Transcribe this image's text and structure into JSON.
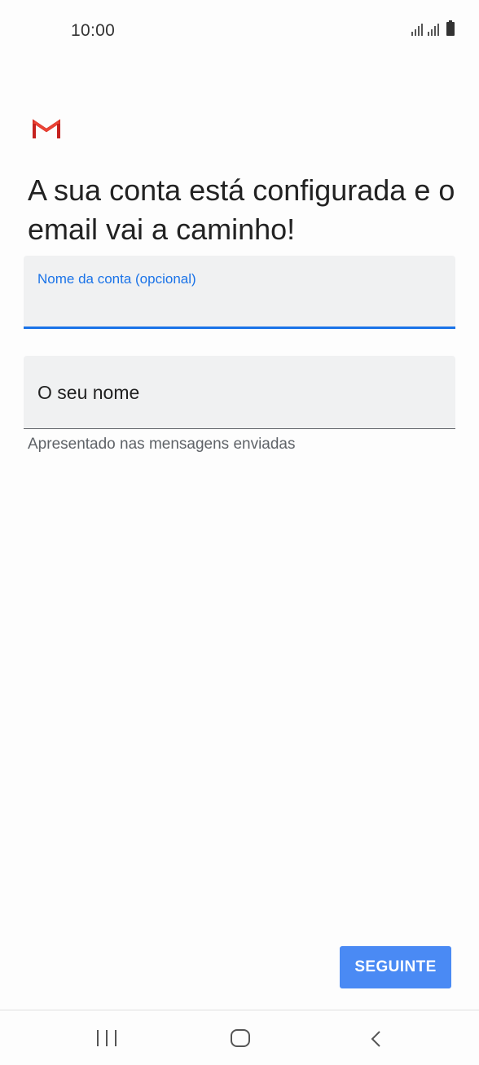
{
  "status_bar": {
    "time": "10:00",
    "icons": [
      "signal-icon",
      "signal-icon",
      "battery-icon"
    ]
  },
  "app": {
    "logo_icon": "gmail-icon",
    "colors": {
      "accent": "#1a73e8",
      "button": "#4a8af4",
      "gmail_red": "#d93025"
    }
  },
  "heading": "A sua conta está configurada e o email vai a caminho!",
  "account_name_field": {
    "label": "Nome da conta (opcional)",
    "value": ""
  },
  "your_name_field": {
    "label": "O seu nome",
    "value": "",
    "helper": "Apresentado nas mensagens enviadas"
  },
  "next_button_label": "SEGUINTE",
  "nav_bar": {
    "icons": [
      "recents-icon",
      "home-icon",
      "back-icon"
    ]
  }
}
